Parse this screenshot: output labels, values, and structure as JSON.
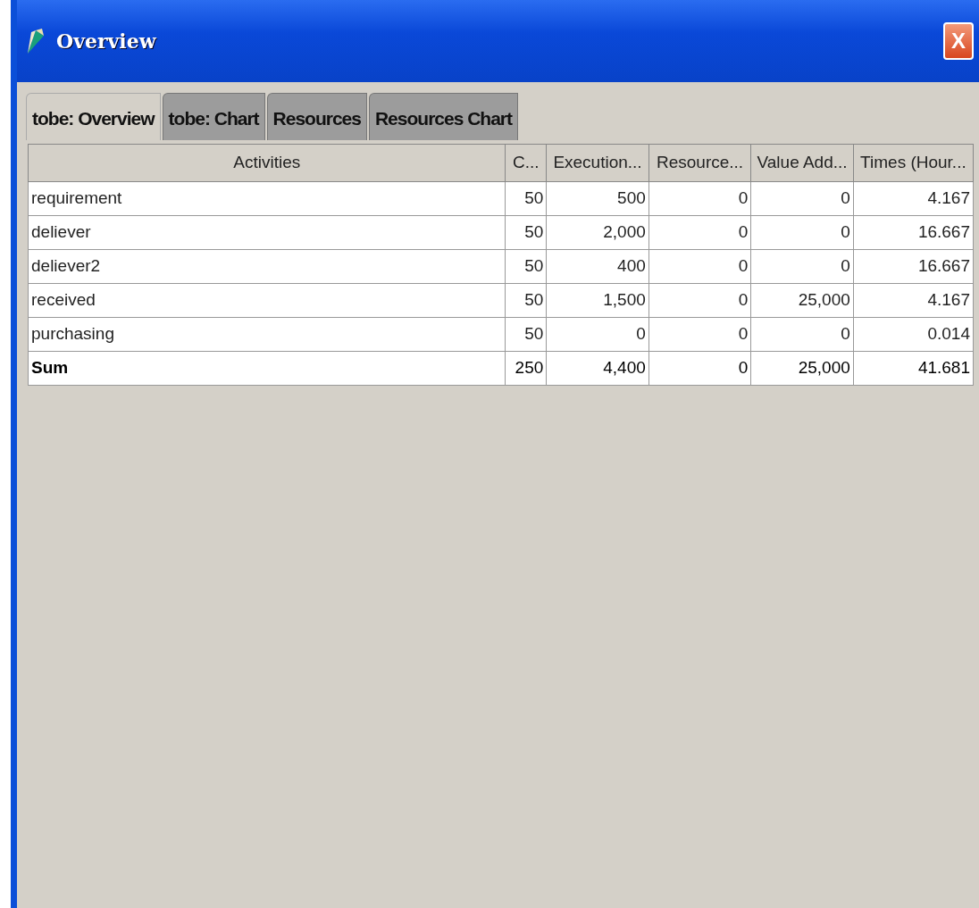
{
  "window": {
    "title": "Overview",
    "close": "X"
  },
  "tabs": [
    {
      "label": "tobe: Overview",
      "selected": true
    },
    {
      "label": "tobe: Chart",
      "selected": false
    },
    {
      "label": "Resources",
      "selected": false
    },
    {
      "label": "Resources Chart",
      "selected": false
    }
  ],
  "table": {
    "columns": [
      "Activities",
      "C...",
      "Execution...",
      "Resource...",
      "Value Add...",
      "Times (Hour..."
    ],
    "rows": [
      {
        "kind": "item",
        "cells": [
          "requirement",
          "50",
          "500",
          "0",
          "0",
          "4.167"
        ]
      },
      {
        "kind": "item",
        "cells": [
          "deliever",
          "50",
          "2,000",
          "0",
          "0",
          "16.667"
        ]
      },
      {
        "kind": "item",
        "cells": [
          "deliever2",
          "50",
          "400",
          "0",
          "0",
          "16.667"
        ]
      },
      {
        "kind": "item",
        "cells": [
          "received",
          "50",
          "1,500",
          "0",
          "25,000",
          "4.167"
        ]
      },
      {
        "kind": "item",
        "cells": [
          "purchasing",
          "50",
          "0",
          "0",
          "0",
          "0.014"
        ]
      },
      {
        "kind": "total",
        "cells": [
          "Sum",
          "250",
          "4,400",
          "0",
          "25,000",
          "41.681"
        ]
      }
    ]
  }
}
